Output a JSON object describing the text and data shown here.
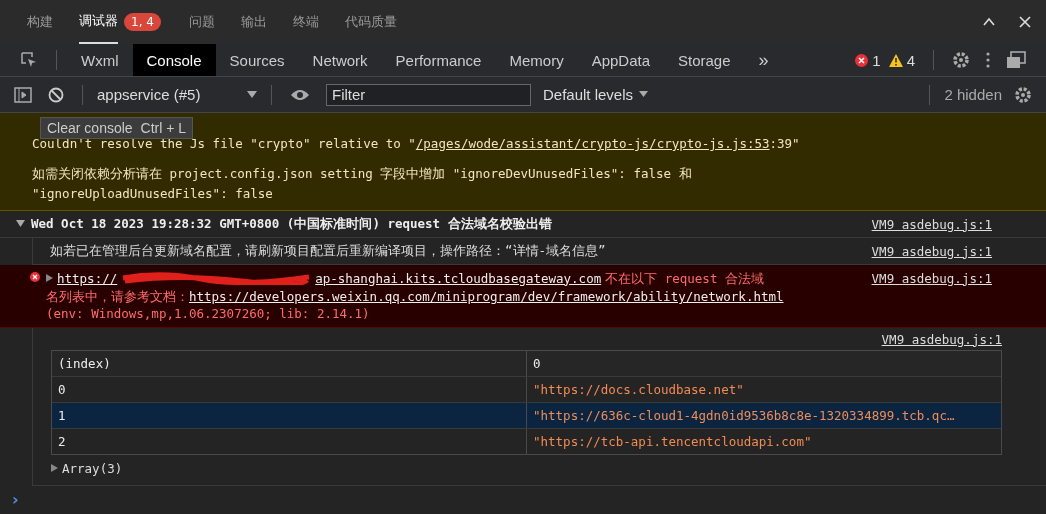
{
  "panel_tabs": [
    {
      "label": "构建",
      "selected": false
    },
    {
      "label": "调试器",
      "selected": true,
      "badge": "1, 4"
    },
    {
      "label": "问题",
      "selected": false
    },
    {
      "label": "输出",
      "selected": false
    },
    {
      "label": "终端",
      "selected": false
    },
    {
      "label": "代码质量",
      "selected": false
    }
  ],
  "devtools_tabs": [
    {
      "label": "Wxml",
      "selected": false
    },
    {
      "label": "Console",
      "selected": true
    },
    {
      "label": "Sources",
      "selected": false
    },
    {
      "label": "Network",
      "selected": false
    },
    {
      "label": "Performance",
      "selected": false
    },
    {
      "label": "Memory",
      "selected": false
    },
    {
      "label": "AppData",
      "selected": false
    },
    {
      "label": "Storage",
      "selected": false
    }
  ],
  "more_tabs": "»",
  "error_count": "1",
  "warning_count": "4",
  "toolbar": {
    "context": "appservice (#5)",
    "filter_placeholder": "Filter",
    "levels": "Default levels",
    "hidden": "2 hidden"
  },
  "tooltip": {
    "label": "Clear console",
    "shortcut": "Ctrl + L"
  },
  "warning": {
    "line1_before": "Couldn't resolve the Js file \"crypto\" relative to \"",
    "line1_link": "/pages/wode/assistant/crypto-js/crypto-js.js:53",
    "line1_after": ":39\"",
    "line2": "如需关闭依赖分析请在 project.config.json setting 字段中增加 \"ignoreDevUnusedFiles\": false 和",
    "line3": "\"ignoreUploadUnusedFiles\": false"
  },
  "group": {
    "expanded": true,
    "title": "Wed Oct 18 2023 19:28:32 GMT+0800 (中国标准时间) request 合法域名校验出错",
    "source": "VM9 asdebug.js:1"
  },
  "info": {
    "text": "如若已在管理后台更新域名配置，请刷新项目配置后重新编译项目，操作路径：“详情-域名信息”",
    "source": "VM9 asdebug.js:1"
  },
  "error": {
    "link_start": "https://",
    "link_end": "ap-shanghai.kits.tcloudbasegateway.com",
    "text1": "不在以下 request 合法域",
    "text2": "名列表中，请参考文档：",
    "doc_link": "https://developers.weixin.qq.com/miniprogram/dev/framework/ability/network.html",
    "env": "(env: Windows,mp,1.06.2307260; lib: 2.14.1)",
    "source": "VM9 asdebug.js:1"
  },
  "table_source": "VM9 asdebug.js:1",
  "table": {
    "columns": [
      "(index)",
      "0"
    ],
    "rows": [
      {
        "index": "0",
        "value": "\"https://docs.cloudbase.net\"",
        "selected": false
      },
      {
        "index": "1",
        "value": "\"https://636c-cloud1-4gdn0id9536b8c8e-1320334899.tcb.qc…",
        "selected": true
      },
      {
        "index": "2",
        "value": "\"https://tcb-api.tencentcloudapi.com\"",
        "selected": false
      }
    ]
  },
  "array_label": "Array(3)",
  "prompt": "›"
}
